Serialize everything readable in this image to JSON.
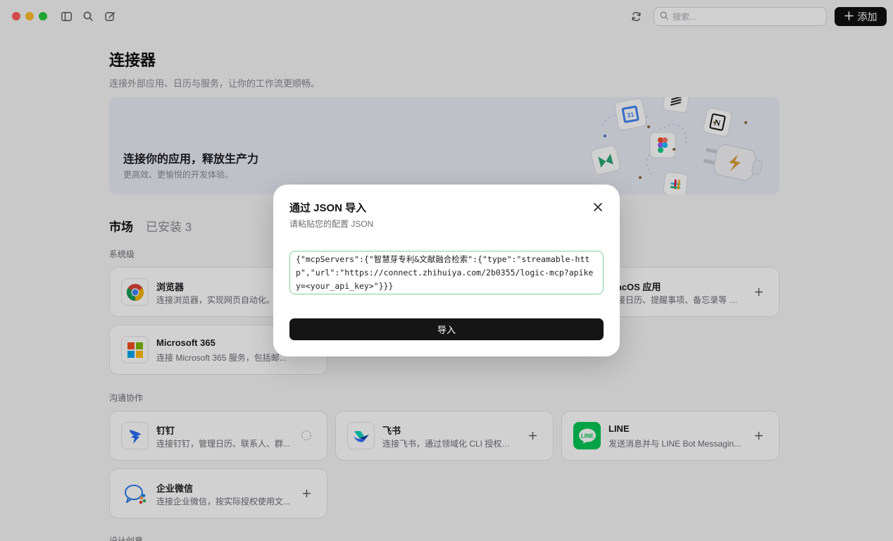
{
  "titlebar": {
    "search_placeholder": "搜索...",
    "add_label": "添加"
  },
  "page": {
    "title": "连接器",
    "subtitle": "连接外部应用、日历与服务，让你的工作流更顺畅。"
  },
  "banner": {
    "title": "连接你的应用，释放生产力",
    "subtitle": "更高效、更愉悦的开发体验。"
  },
  "tabs": {
    "market": "市场",
    "installed": "已安装 3"
  },
  "sections": {
    "system": "系统级",
    "communication": "沟通协作",
    "design": "设计创意"
  },
  "cards": {
    "browser": {
      "name": "浏览器",
      "desc": "连接浏览器，实现网页自动化。"
    },
    "macos": {
      "name": "macOS 应用",
      "desc": "连接日历、提醒事项、备忘录等 m..."
    },
    "microsoft": {
      "name": "Microsoft 365",
      "desc": "连接 Microsoft 365 服务，包括邮..."
    },
    "dingtalk": {
      "name": "钉钉",
      "desc": "连接钉钉，管理日历、联系人、群..."
    },
    "feishu": {
      "name": "飞书",
      "desc": "连接飞书，通过领域化 CLI 授权调..."
    },
    "line": {
      "name": "LINE",
      "desc": "发送消息并与 LINE Bot Messagin..."
    },
    "wecom": {
      "name": "企业微信",
      "desc": "连接企业微信，按实际授权使用文..."
    }
  },
  "modal": {
    "title": "通过 JSON 导入",
    "subtitle": "请粘贴您的配置 JSON",
    "json_value": "{\"mcpServers\":{\"智慧芽专利&文献融合检索\":{\"type\":\"streamable-http\",\"url\":\"https://connect.zhihuiya.com/2b0355/logic-mcp?apikey=<your_api_key>\"}}}",
    "import_label": "导入"
  }
}
